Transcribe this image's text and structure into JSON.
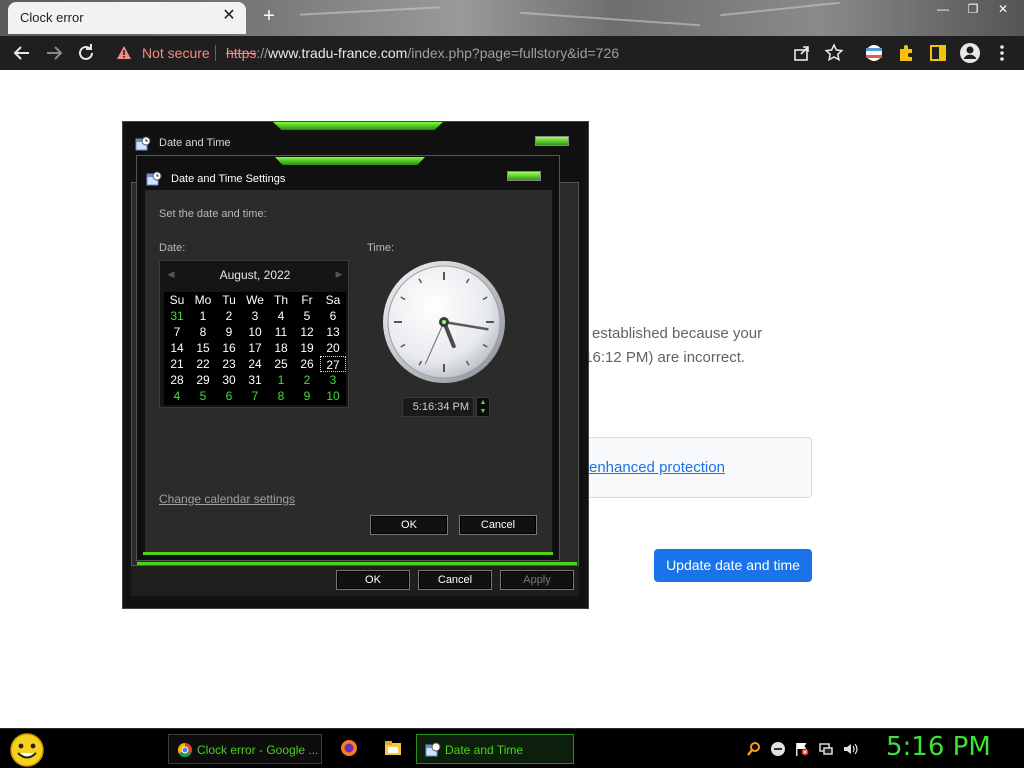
{
  "browser": {
    "tab_title": "Clock error",
    "tab_close": "✕",
    "new_tab": "+",
    "window_controls": [
      "—",
      "❐",
      "✕"
    ],
    "security_label": "Not secure",
    "url_scheme": "https",
    "url_host": "www.tradu-france.com",
    "url_path": "/index.php?page=fullstory&id=726"
  },
  "page": {
    "text_line1": "established because your",
    "text_line2": ":16:12 PM) are incorrect.",
    "enhanced_link": "enhanced protection",
    "update_button": "Update date and time"
  },
  "outer_dialog": {
    "title": "Date and Time",
    "ok": "OK",
    "cancel": "Cancel",
    "apply": "Apply"
  },
  "inner_dialog": {
    "title": "Date and Time Settings",
    "instruction": "Set the date and time:",
    "date_label": "Date:",
    "time_label": "Time:",
    "month_year": "August, 2022",
    "prev_arrow": "◀",
    "next_arrow": "▶",
    "weekdays": [
      "Su",
      "Mo",
      "Tu",
      "We",
      "Th",
      "Fr",
      "Sa"
    ],
    "weeks": [
      [
        "31",
        "1",
        "2",
        "3",
        "4",
        "5",
        "6"
      ],
      [
        "7",
        "8",
        "9",
        "10",
        "11",
        "12",
        "13"
      ],
      [
        "14",
        "15",
        "16",
        "17",
        "18",
        "19",
        "20"
      ],
      [
        "21",
        "22",
        "23",
        "24",
        "25",
        "26",
        "27"
      ],
      [
        "28",
        "29",
        "30",
        "31",
        "1",
        "2",
        "3"
      ],
      [
        "4",
        "5",
        "6",
        "7",
        "8",
        "9",
        "10"
      ]
    ],
    "selected_day": "27",
    "time_value": "5:16:34 PM",
    "clock_time": {
      "hour": 5,
      "minute": 16,
      "second": 34
    },
    "spin_up": "▲",
    "spin_down": "▼",
    "change_calendar_link": "Change calendar settings",
    "ok": "OK",
    "cancel": "Cancel"
  },
  "taskbar": {
    "chrome_task": "Clock error - Google ...",
    "datetime_task": "Date and Time",
    "clock": "5:16 PM"
  },
  "colors": {
    "accent_green": "#3ee03a",
    "chrome_blue": "#1a73e8",
    "not_secure_red": "#f28b82"
  }
}
